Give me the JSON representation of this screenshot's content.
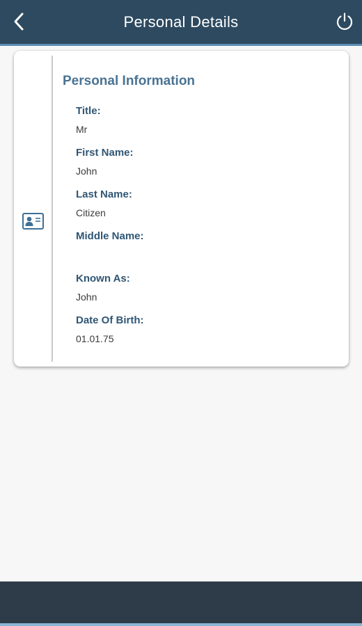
{
  "header": {
    "title": "Personal Details",
    "back_icon": "chevron-left-icon",
    "power_icon": "power-icon",
    "background": "#2d4a60",
    "accent_line": "#5d8db3"
  },
  "card": {
    "icon": "id-card-icon",
    "section_title": "Personal Information",
    "fields": [
      {
        "label": "Title:",
        "value": "Mr"
      },
      {
        "label": "First Name:",
        "value": "John"
      },
      {
        "label": "Last Name:",
        "value": "Citizen"
      },
      {
        "label": "Middle Name:",
        "value": ""
      },
      {
        "label": "Known As:",
        "value": "John"
      },
      {
        "label": "Date Of Birth:",
        "value": "01.01.75"
      }
    ]
  },
  "colors": {
    "label": "#2f5674",
    "section_title": "#4a7393",
    "footer": "#2e3c49"
  }
}
